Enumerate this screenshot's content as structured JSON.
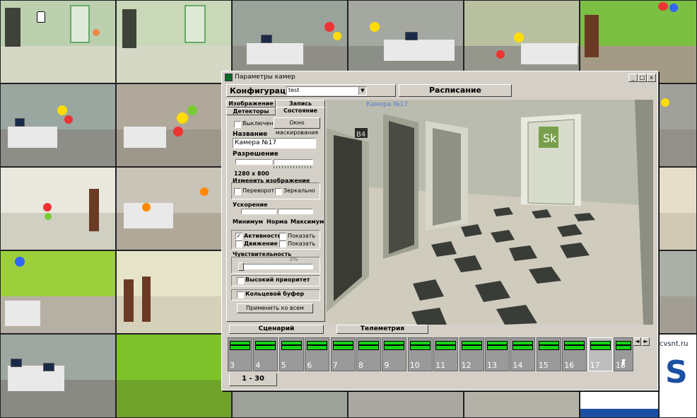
{
  "dialog": {
    "title": "Параметры камер",
    "config_label": "Конфигурация",
    "config_value": "test",
    "schedule_label": "Расписание",
    "window_buttons": [
      "_",
      "□",
      "x"
    ]
  },
  "tabs": {
    "row1": [
      "Изображение",
      "Запись"
    ],
    "row2": [
      "Детекторы",
      "Состояние"
    ]
  },
  "state": {
    "disabled_label": "Выключена",
    "mask_button": "Окно маскирования",
    "name_label": "Название",
    "name_value": "Камера №17",
    "resolution_label": "Разрешение",
    "resolution_value": "1280 x 800",
    "change_image_label": "Изменить изображение",
    "flip_label": "Переворот",
    "mirror_label": "Зеркально",
    "accel_label": "Ускорение",
    "accel_min": "Минимум",
    "accel_norm": "Норма",
    "accel_max": "Максимум",
    "activity_label": "Активность",
    "activity_checked": true,
    "show_label_1": "Показать",
    "motion_label": "Движение",
    "show_label_2": "Показать",
    "sensitivity_label": "Чувствительность",
    "sensitivity_value": "3%",
    "high_priority_label": "Высокий приоритет",
    "ring_buffer_label": "Кольцевой буфер",
    "apply_all_button": "Применить ко всем"
  },
  "video": {
    "caption": "Камера №17",
    "sign_b4": "B4",
    "sign_sk": "Sk"
  },
  "bottom": {
    "scenario_button": "Сценарий",
    "telemetry_button": "Телеметрия",
    "page_tab": "1 - 30",
    "selected_camera": "17",
    "cameras": [
      "3",
      "4",
      "5",
      "6",
      "7",
      "8",
      "9",
      "10",
      "11",
      "12",
      "13",
      "14",
      "15",
      "16",
      "17",
      "18"
    ]
  },
  "background": {
    "logo_text": "cvsnt.ru",
    "logo_letter": "S"
  },
  "colors": {
    "titlebar": "#d4d0c8",
    "face": "#d4d0c8",
    "caption": "#5b7bd4",
    "thumb_bar": "#19d219"
  }
}
